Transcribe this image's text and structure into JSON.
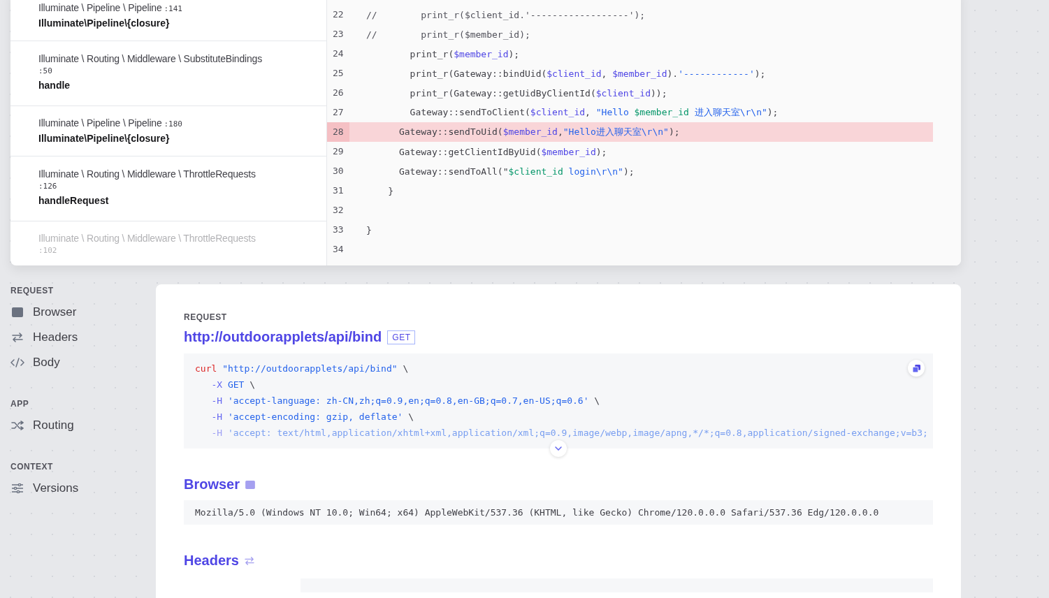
{
  "stack_frames": [
    {
      "path": "Illuminate \\ Pipeline \\ Pipeline",
      "line": ":141",
      "method": "Illuminate\\Pipeline\\{closure}",
      "faded": false
    },
    {
      "path": "Illuminate \\ Routing \\ Middleware \\ SubstituteBindings",
      "line": ":50",
      "method": "handle",
      "faded": false
    },
    {
      "path": "Illuminate \\ Pipeline \\ Pipeline",
      "line": ":180",
      "method": "Illuminate\\Pipeline\\{closure}",
      "faded": false
    },
    {
      "path": "Illuminate \\ Routing \\ Middleware \\ ThrottleRequests",
      "line": ":126",
      "method": "handleRequest",
      "faded": false
    },
    {
      "path": "Illuminate \\ Routing \\ Middleware \\ ThrottleRequests",
      "line": ":102",
      "faded": true
    }
  ],
  "code": {
    "lines": [
      {
        "number": "22",
        "highlighted": false,
        "tokens": [
          {
            "kind": "comment",
            "text": "//        print_r($client_id.'------------------');"
          }
        ]
      },
      {
        "number": "23",
        "highlighted": false,
        "tokens": [
          {
            "kind": "comment",
            "text": "//        print_r($member_id);"
          }
        ]
      },
      {
        "number": "24",
        "highlighted": false,
        "tokens": [
          {
            "kind": "plain",
            "text": "        print_r("
          },
          {
            "kind": "var",
            "text": "$member_id"
          },
          {
            "kind": "plain",
            "text": ");"
          }
        ]
      },
      {
        "number": "25",
        "highlighted": false,
        "tokens": [
          {
            "kind": "plain",
            "text": "        print_r(Gateway::bindUid("
          },
          {
            "kind": "var",
            "text": "$client_id"
          },
          {
            "kind": "plain",
            "text": ", "
          },
          {
            "kind": "var",
            "text": "$member_id"
          },
          {
            "kind": "plain",
            "text": ")."
          },
          {
            "kind": "str",
            "text": "'------------'"
          },
          {
            "kind": "plain",
            "text": ");"
          }
        ]
      },
      {
        "number": "26",
        "highlighted": false,
        "tokens": [
          {
            "kind": "plain",
            "text": "        print_r(Gateway::getUidByClientId("
          },
          {
            "kind": "var",
            "text": "$client_id"
          },
          {
            "kind": "plain",
            "text": "));"
          }
        ]
      },
      {
        "number": "27",
        "highlighted": false,
        "tokens": [
          {
            "kind": "plain",
            "text": "        Gateway::sendToClient("
          },
          {
            "kind": "var",
            "text": "$client_id"
          },
          {
            "kind": "plain",
            "text": ", "
          },
          {
            "kind": "str",
            "text": "\"Hello "
          },
          {
            "kind": "interp",
            "text": "$member_id"
          },
          {
            "kind": "str",
            "text": " 进入聊天室\\r\\n\""
          },
          {
            "kind": "plain",
            "text": ");"
          }
        ]
      },
      {
        "number": "28",
        "highlighted": true,
        "tokens": [
          {
            "kind": "plain",
            "text": "      Gateway::sendToUid("
          },
          {
            "kind": "var",
            "text": "$member_id"
          },
          {
            "kind": "plain",
            "text": ","
          },
          {
            "kind": "str",
            "text": "\"Hello进入聊天室\\r\\n\""
          },
          {
            "kind": "plain",
            "text": ");"
          }
        ]
      },
      {
        "number": "29",
        "highlighted": false,
        "tokens": [
          {
            "kind": "plain",
            "text": "      Gateway::getClientIdByUid("
          },
          {
            "kind": "var",
            "text": "$member_id"
          },
          {
            "kind": "plain",
            "text": ");"
          }
        ]
      },
      {
        "number": "30",
        "highlighted": false,
        "tokens": [
          {
            "kind": "plain",
            "text": "      Gateway::sendToAll(\""
          },
          {
            "kind": "interp",
            "text": "$client_id"
          },
          {
            "kind": "str",
            "text": " login\\r\\n\""
          },
          {
            "kind": "plain",
            "text": ");"
          }
        ]
      },
      {
        "number": "31",
        "highlighted": false,
        "tokens": [
          {
            "kind": "plain",
            "text": "    }"
          }
        ]
      },
      {
        "number": "32",
        "highlighted": false
      },
      {
        "number": "33",
        "highlighted": false,
        "tokens": [
          {
            "kind": "plain",
            "text": "}"
          }
        ]
      },
      {
        "number": "34",
        "highlighted": false
      }
    ]
  },
  "sidebar": {
    "sections": [
      {
        "title": "REQUEST",
        "items": [
          {
            "label": "Browser"
          },
          {
            "label": "Headers"
          },
          {
            "label": "Body"
          }
        ]
      },
      {
        "title": "APP",
        "items": [
          {
            "label": "Routing"
          }
        ]
      },
      {
        "title": "CONTEXT",
        "items": [
          {
            "label": "Versions"
          }
        ]
      }
    ]
  },
  "request": {
    "section_label": "REQUEST",
    "url": "http://outdoorapplets/api/bind",
    "method": "GET",
    "curl_lines": [
      {
        "faded": false,
        "tokens": [
          {
            "kind": "keyword",
            "text": "curl"
          },
          {
            "kind": "str",
            "text": " \"http://outdoorapplets/api/bind\""
          },
          {
            "kind": "plain",
            "text": " \\"
          }
        ]
      },
      {
        "faded": false,
        "tokens": [
          {
            "kind": "flag",
            "text": "   -X"
          },
          {
            "kind": "str",
            "text": " GET"
          },
          {
            "kind": "plain",
            "text": " \\"
          }
        ]
      },
      {
        "faded": false,
        "tokens": [
          {
            "kind": "flag",
            "text": "   -H"
          },
          {
            "kind": "str",
            "text": " 'accept-language: zh-CN,zh;q=0.9,en;q=0.8,en-GB;q=0.7,en-US;q=0.6'"
          },
          {
            "kind": "plain",
            "text": " \\"
          }
        ]
      },
      {
        "faded": false,
        "tokens": [
          {
            "kind": "flag",
            "text": "   -H"
          },
          {
            "kind": "str",
            "text": " 'accept-encoding: gzip, deflate'"
          },
          {
            "kind": "plain",
            "text": " \\"
          }
        ]
      },
      {
        "faded": true,
        "tokens": [
          {
            "kind": "flag",
            "text": "   -H"
          },
          {
            "kind": "str",
            "text": " 'accept: text/html,application/xhtml+xml,application/xml;q=0.9,image/webp,image/apng,*/*;q=0.8,application/signed-exchange;v=b3;"
          }
        ]
      }
    ],
    "browser": {
      "heading": "Browser",
      "user_agent": "Mozilla/5.0 (Windows NT 10.0; Win64; x64) AppleWebKit/537.36 (KHTML, like Gecko) Chrome/120.0.0.0 Safari/537.36 Edg/120.0.0.0"
    },
    "headers": {
      "heading": "Headers"
    }
  }
}
